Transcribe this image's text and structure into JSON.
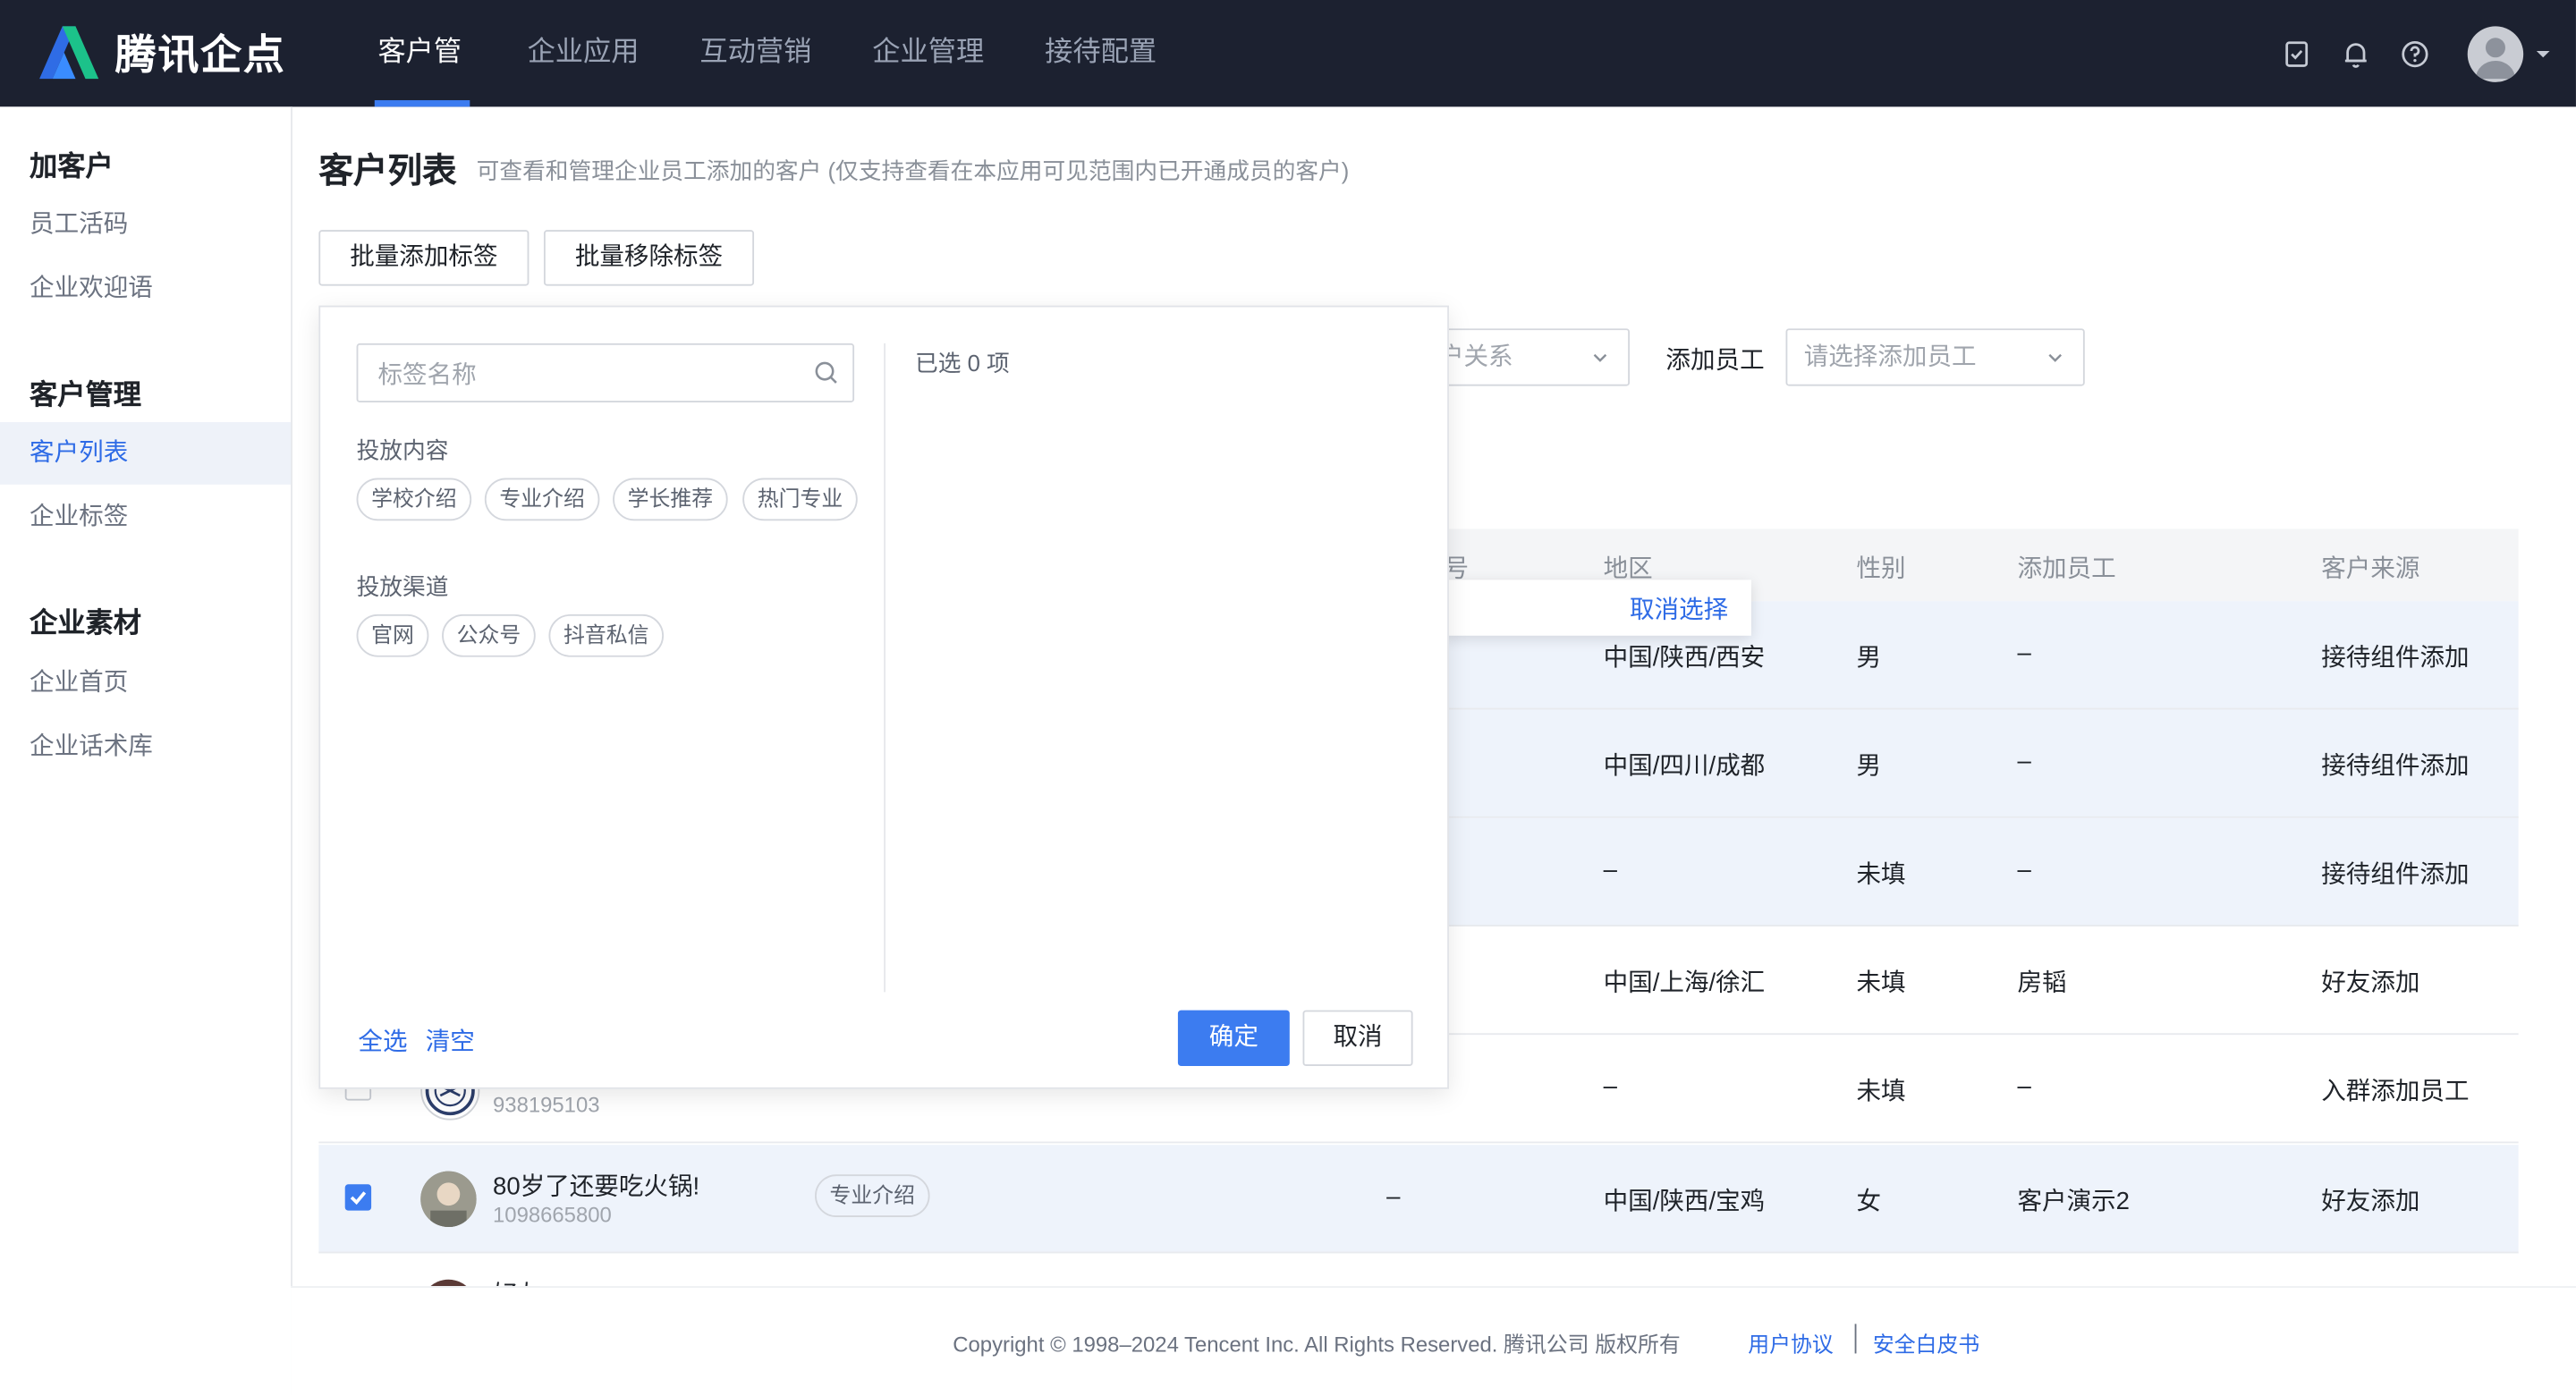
{
  "app": {
    "logo_text": "腾讯企点"
  },
  "nav": {
    "items": [
      {
        "label": "客户管理"
      },
      {
        "label": "企业应用"
      },
      {
        "label": "互动营销"
      },
      {
        "label": "企业管理"
      },
      {
        "label": "接待配置"
      }
    ],
    "icons": [
      "task-check-icon",
      "bell-icon",
      "help-icon",
      "avatar",
      "caret-down-icon"
    ]
  },
  "sidebar": {
    "groups": [
      {
        "title": "加客户",
        "items": [
          "员工活码",
          "企业欢迎语"
        ]
      },
      {
        "title": "客户管理",
        "items": [
          "客户列表",
          "企业标签"
        ]
      },
      {
        "title": "企业素材",
        "items": [
          "企业首页",
          "企业话术库"
        ]
      }
    ],
    "active": "客户列表"
  },
  "page": {
    "title": "客户列表",
    "subtitle": "可查看和管理企业员工添加的客户 (仅支持查看在本应用可见范围内已开通成员的客户)",
    "batch_add_tag": "批量添加标签",
    "batch_remove_tag": "批量移除标签"
  },
  "filters": {
    "relation_placeholder": "客户关系",
    "staff_label": "添加员工",
    "staff_placeholder": "请选择添加员工"
  },
  "table": {
    "headers": {
      "phone": "号",
      "region": "地区",
      "gender": "性别",
      "staff": "添加员工",
      "source": "客户来源"
    },
    "cancel_selection": "取消选择",
    "rows": [
      {
        "region": "中国/陕西/西安",
        "gender": "男",
        "staff": "–",
        "source": "接待组件添加"
      },
      {
        "region": "中国/四川/成都",
        "gender": "男",
        "staff": "–",
        "source": "接待组件添加"
      },
      {
        "region": "–",
        "gender": "未填",
        "staff": "–",
        "source": "接待组件添加"
      },
      {
        "region": "中国/上海/徐汇",
        "gender": "未填",
        "staff": "房韬",
        "source": "好友添加"
      },
      {
        "id": "938195103",
        "phone": "–",
        "region": "–",
        "gender": "未填",
        "staff": "–",
        "source": "入群添加员工"
      },
      {
        "name": "80岁了还要吃火锅!",
        "id": "1098665800",
        "tag": "专业介绍",
        "phone": "–",
        "region": "中国/陕西/宝鸡",
        "gender": "女",
        "staff": "客户演示2",
        "source": "好友添加",
        "checked": true
      },
      {
        "name": "好友"
      }
    ]
  },
  "tag_panel": {
    "search_placeholder": "标签名称",
    "groups": [
      {
        "title": "投放内容",
        "tags": [
          "学校介绍",
          "专业介绍",
          "学长推荐",
          "热门专业"
        ]
      },
      {
        "title": "投放渠道",
        "tags": [
          "官网",
          "公众号",
          "抖音私信"
        ]
      }
    ],
    "selected_count": "已选 0 项",
    "select_all": "全选",
    "clear": "清空",
    "confirm": "确定",
    "cancel": "取消"
  },
  "footer": {
    "copyright": "Copyright © 1998–2024 Tencent Inc. All Rights Reserved. 腾讯公司 版权所有",
    "user_agreement": "用户协议",
    "security_whitepaper": "安全白皮书"
  },
  "colors": {
    "primary": "#3c7cf0",
    "topbar": "#1c2130",
    "link": "#2e6be6"
  }
}
